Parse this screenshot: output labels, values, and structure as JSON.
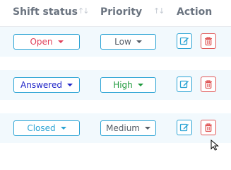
{
  "table": {
    "columns": {
      "shift_status": "Shift status",
      "priority": "Priority",
      "action": "Action"
    },
    "rows": [
      {
        "status": {
          "value": "Open",
          "color": "#e0405a"
        },
        "priority": {
          "value": "Low",
          "color": "#555c66"
        },
        "actions": {
          "edit_icon": "edit-icon",
          "delete_icon": "trash-icon"
        }
      },
      {
        "status": {
          "value": "Answered",
          "color": "#1f24c8"
        },
        "priority": {
          "value": "High",
          "color": "#1f9a3d"
        },
        "actions": {
          "edit_icon": "edit-icon",
          "delete_icon": "trash-icon"
        }
      },
      {
        "status": {
          "value": "Closed",
          "color": "#2ba3d4"
        },
        "priority": {
          "value": "Medium",
          "color": "#555c66"
        },
        "actions": {
          "edit_icon": "edit-icon",
          "delete_icon": "trash-icon"
        }
      }
    ]
  },
  "colors": {
    "accent": "#2ba3d4",
    "danger": "#e05656",
    "row_highlight": "#f2f9fd",
    "header_text": "#6b7480"
  }
}
